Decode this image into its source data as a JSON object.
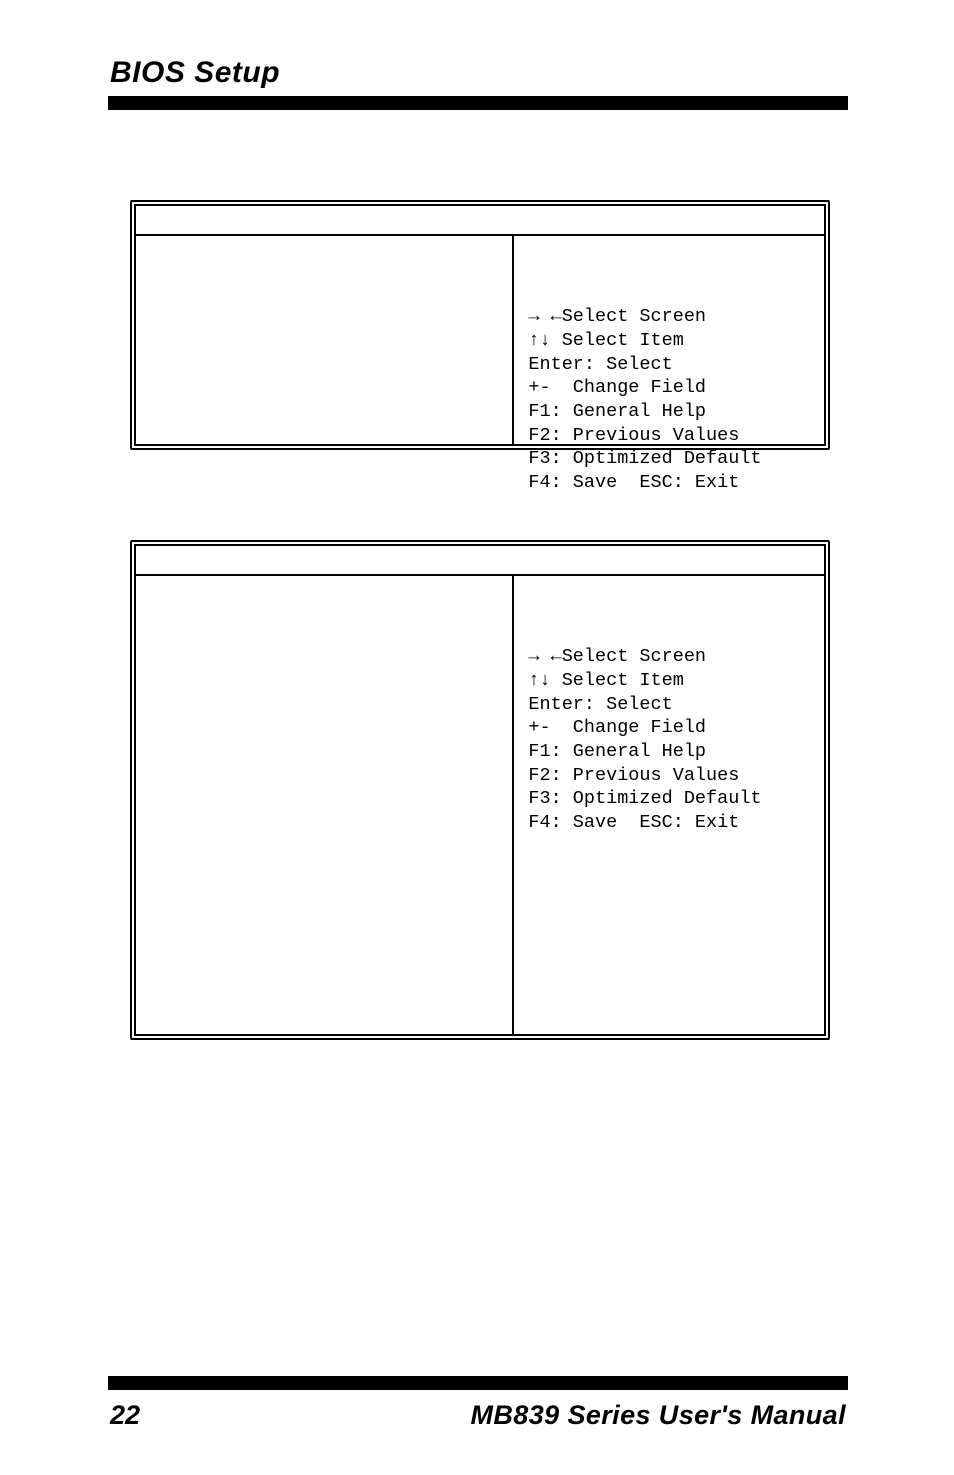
{
  "header": {
    "title": "BIOS Setup"
  },
  "box1": {
    "help": "→ ←Select Screen\n↑↓ Select Item\nEnter: Select\n+-  Change Field\nF1: General Help\nF2: Previous Values\nF3: Optimized Default\nF4: Save  ESC: Exit"
  },
  "box2": {
    "help": "→ ←Select Screen\n↑↓ Select Item\nEnter: Select\n+-  Change Field\nF1: General Help\nF2: Previous Values\nF3: Optimized Default\nF4: Save  ESC: Exit"
  },
  "footer": {
    "page": "22",
    "manual": "MB839 Series User's Manual"
  }
}
